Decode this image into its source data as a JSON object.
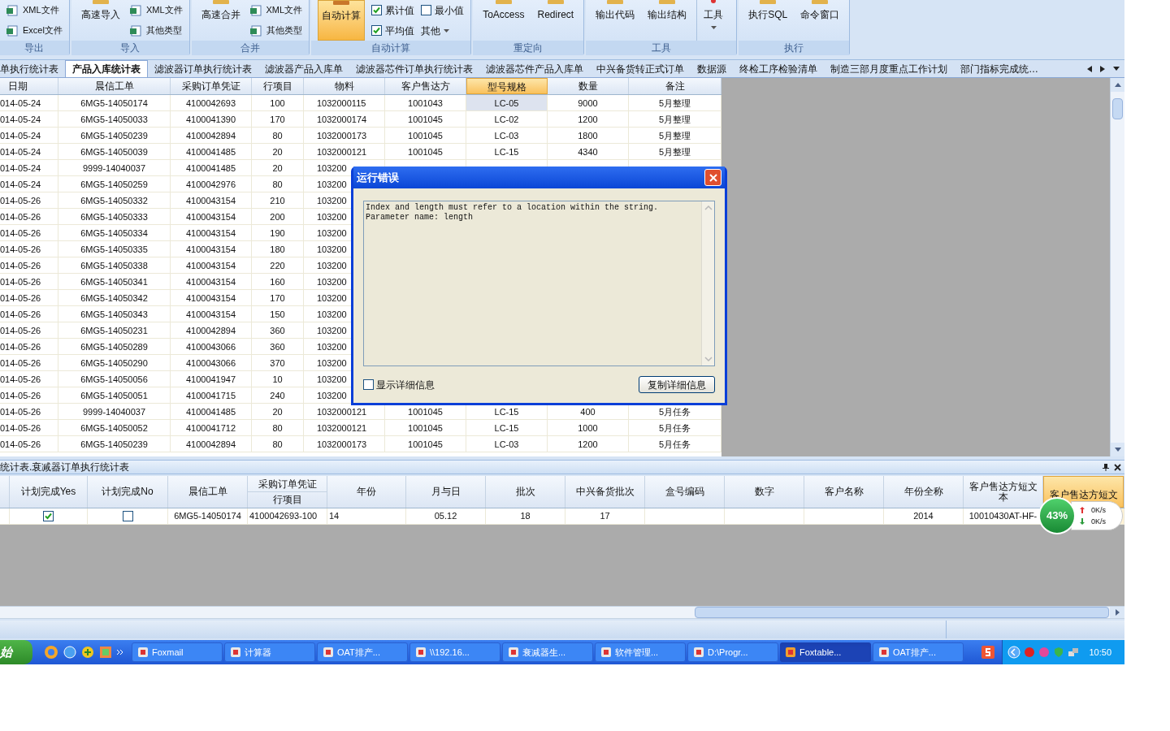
{
  "ribbon": {
    "groups": [
      {
        "label": "导出",
        "items": [
          {
            "kind": "small",
            "label": "XML文件"
          },
          {
            "kind": "small",
            "label": "Excel文件"
          }
        ]
      },
      {
        "label": "导入",
        "items": [
          {
            "kind": "big",
            "label": "高速导入",
            "selected": false
          },
          {
            "kind": "small",
            "label": "XML文件"
          },
          {
            "kind": "small",
            "label": "其他类型"
          }
        ]
      },
      {
        "label": "合并",
        "items": [
          {
            "kind": "big",
            "label": "高速合并",
            "selected": false
          },
          {
            "kind": "small",
            "label": "XML文件"
          },
          {
            "kind": "small",
            "label": "其他类型"
          }
        ]
      },
      {
        "label": "自动计算",
        "items": [
          {
            "kind": "big",
            "label": "自动计算",
            "selected": true
          },
          {
            "kind": "check",
            "label": "累计值",
            "checked": true
          },
          {
            "kind": "check",
            "label": "最小值",
            "checked": false
          },
          {
            "kind": "check",
            "label": "平均值",
            "checked": true
          },
          {
            "kind": "dropdown",
            "label": "其他"
          }
        ]
      },
      {
        "label": "重定向",
        "items": [
          {
            "kind": "big",
            "label": "ToAccess",
            "selected": false
          },
          {
            "kind": "big",
            "label": "Redirect",
            "selected": false
          }
        ]
      },
      {
        "label": "工具",
        "items": [
          {
            "kind": "big",
            "label": "输出代码",
            "selected": false
          },
          {
            "kind": "big",
            "label": "输出结构",
            "selected": false
          },
          {
            "kind": "menu",
            "label": "工具"
          }
        ]
      },
      {
        "label": "执行",
        "items": [
          {
            "kind": "big",
            "label": "执行SQL",
            "selected": false
          },
          {
            "kind": "big",
            "label": "命令窗口",
            "selected": false
          }
        ]
      }
    ]
  },
  "tabs": [
    {
      "label": "单执行统计表",
      "selected": false
    },
    {
      "label": "产品入库统计表",
      "selected": true
    },
    {
      "label": "滤波器订单执行统计表",
      "selected": false
    },
    {
      "label": "滤波器产品入库单",
      "selected": false
    },
    {
      "label": "滤波器芯件订单执行统计表",
      "selected": false
    },
    {
      "label": "滤波器芯件产品入库单",
      "selected": false
    },
    {
      "label": "中兴备货转正式订单",
      "selected": false
    },
    {
      "label": "数据源",
      "selected": false
    },
    {
      "label": "终检工序检验清单",
      "selected": false
    },
    {
      "label": "制造三部月度重点工作计划",
      "selected": false
    },
    {
      "label": "部门指标完成统…",
      "selected": false
    }
  ],
  "table": {
    "columns": [
      {
        "label": "日期",
        "selected": false
      },
      {
        "label": "晨信工单",
        "selected": false
      },
      {
        "label": "采购订单凭证",
        "selected": false
      },
      {
        "label": "行项目",
        "selected": false
      },
      {
        "label": "物料",
        "selected": false
      },
      {
        "label": "客户售达方",
        "selected": false
      },
      {
        "label": "型号规格",
        "selected": true
      },
      {
        "label": "数量",
        "selected": false
      },
      {
        "label": "备注",
        "selected": false
      }
    ],
    "rows": [
      {
        "selected": true,
        "cells": [
          "014-05-24",
          "6MG5-14050174",
          "4100042693",
          "100",
          "1032000115",
          "1001043",
          "LC-05",
          "9000",
          "5月整理"
        ]
      },
      {
        "selected": false,
        "cells": [
          "014-05-24",
          "6MG5-14050033",
          "4100041390",
          "170",
          "1032000174",
          "1001045",
          "LC-02",
          "1200",
          "5月整理"
        ]
      },
      {
        "selected": false,
        "cells": [
          "014-05-24",
          "6MG5-14050239",
          "4100042894",
          "80",
          "1032000173",
          "1001045",
          "LC-03",
          "1800",
          "5月整理"
        ]
      },
      {
        "selected": false,
        "cells": [
          "014-05-24",
          "6MG5-14050039",
          "4100041485",
          "20",
          "1032000121",
          "1001045",
          "LC-15",
          "4340",
          "5月整理"
        ]
      },
      {
        "selected": false,
        "cells": [
          "014-05-24",
          "9999-14040037",
          "4100041485",
          "20",
          "103200"
        ]
      },
      {
        "selected": false,
        "cells": [
          "014-05-24",
          "6MG5-14050259",
          "4100042976",
          "80",
          "103200"
        ]
      },
      {
        "selected": false,
        "cells": [
          "014-05-26",
          "6MG5-14050332",
          "4100043154",
          "210",
          "103200"
        ]
      },
      {
        "selected": false,
        "cells": [
          "014-05-26",
          "6MG5-14050333",
          "4100043154",
          "200",
          "103200"
        ]
      },
      {
        "selected": false,
        "cells": [
          "014-05-26",
          "6MG5-14050334",
          "4100043154",
          "190",
          "103200"
        ]
      },
      {
        "selected": false,
        "cells": [
          "014-05-26",
          "6MG5-14050335",
          "4100043154",
          "180",
          "103200"
        ]
      },
      {
        "selected": false,
        "cells": [
          "014-05-26",
          "6MG5-14050338",
          "4100043154",
          "220",
          "103200"
        ]
      },
      {
        "selected": false,
        "cells": [
          "014-05-26",
          "6MG5-14050341",
          "4100043154",
          "160",
          "103200"
        ]
      },
      {
        "selected": false,
        "cells": [
          "014-05-26",
          "6MG5-14050342",
          "4100043154",
          "170",
          "103200"
        ]
      },
      {
        "selected": false,
        "cells": [
          "014-05-26",
          "6MG5-14050343",
          "4100043154",
          "150",
          "103200"
        ]
      },
      {
        "selected": false,
        "cells": [
          "014-05-26",
          "6MG5-14050231",
          "4100042894",
          "360",
          "103200"
        ]
      },
      {
        "selected": false,
        "cells": [
          "014-05-26",
          "6MG5-14050289",
          "4100043066",
          "360",
          "103200"
        ]
      },
      {
        "selected": false,
        "cells": [
          "014-05-26",
          "6MG5-14050290",
          "4100043066",
          "370",
          "103200"
        ]
      },
      {
        "selected": false,
        "cells": [
          "014-05-26",
          "6MG5-14050056",
          "4100041947",
          "10",
          "103200"
        ]
      },
      {
        "selected": false,
        "cells": [
          "014-05-26",
          "6MG5-14050051",
          "4100041715",
          "240",
          "103200"
        ]
      },
      {
        "selected": false,
        "cells": [
          "014-05-26",
          "9999-14040037",
          "4100041485",
          "20",
          "1032000121",
          "1001045",
          "LC-15",
          "400",
          "5月任务"
        ]
      },
      {
        "selected": false,
        "cells": [
          "014-05-26",
          "6MG5-14050052",
          "4100041712",
          "80",
          "1032000121",
          "1001045",
          "LC-15",
          "1000",
          "5月任务"
        ]
      },
      {
        "selected": false,
        "cells": [
          "014-05-26",
          "6MG5-14050239",
          "4100042894",
          "80",
          "1032000173",
          "1001045",
          "LC-03",
          "1200",
          "5月任务"
        ]
      }
    ]
  },
  "dialog": {
    "title": "运行错误",
    "lines": [
      "Index and length must refer to a location within the string.",
      "Parameter name: length"
    ],
    "show_details": {
      "label": "显示详细信息",
      "checked": false
    },
    "button": "复制详细信息"
  },
  "panel": {
    "title": "统计表.衰减器订单执行统计表",
    "columns": [
      {
        "kind": "check",
        "label": "计划完成Yes",
        "selected": false,
        "checked": true
      },
      {
        "kind": "check",
        "label": "计划完成No",
        "selected": false,
        "checked": false
      },
      {
        "kind": "text",
        "label": "晨信工单",
        "selected": false,
        "value": "6MG5-14050174"
      },
      {
        "kind": "text",
        "label": "采购订单凭证",
        "sub": "行项目",
        "selected": false,
        "value": "4100042693-100"
      },
      {
        "kind": "text",
        "label": "年份",
        "selected": false,
        "value": "14"
      },
      {
        "kind": "text",
        "label": "月与日",
        "selected": false,
        "value": "05.12"
      },
      {
        "kind": "text",
        "label": "批次",
        "selected": false,
        "value": "18"
      },
      {
        "kind": "text",
        "label": "中兴备货批次",
        "selected": false,
        "value": "17"
      },
      {
        "kind": "text",
        "label": "盒号编码",
        "selected": false
      },
      {
        "kind": "text",
        "label": "数字",
        "selected": false
      },
      {
        "kind": "text",
        "label": "客户名称",
        "selected": false
      },
      {
        "kind": "text",
        "label": "年份全称",
        "selected": false,
        "value": "2014"
      },
      {
        "kind": "text",
        "label": "客户售达方短文本",
        "selected": false,
        "value": "10010430AT-HF-"
      },
      {
        "kind": "text",
        "label": "客户售达方短文",
        "selected": true
      }
    ]
  },
  "net_widget": {
    "percent": "43%",
    "up": "0K/s",
    "down": "0K/s"
  },
  "taskbar": {
    "start": "始",
    "tasks": [
      {
        "label": "Foxmail",
        "selected": false
      },
      {
        "label": "计算器",
        "selected": false
      },
      {
        "label": "OAT排产...",
        "selected": false
      },
      {
        "label": "\\\\192.16...",
        "selected": false
      },
      {
        "label": "衰减器生...",
        "selected": false
      },
      {
        "label": "软件管理...",
        "selected": false
      },
      {
        "label": "D:\\Progr...",
        "selected": false
      },
      {
        "label": "Foxtable...",
        "selected": true
      },
      {
        "label": "OAT排产...",
        "selected": false
      }
    ],
    "clock": "10:50"
  }
}
